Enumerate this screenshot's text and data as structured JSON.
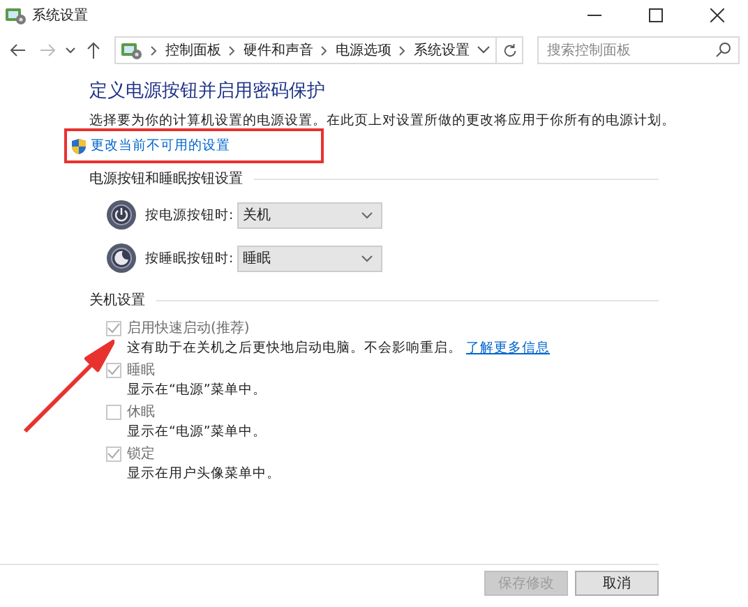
{
  "window": {
    "title": "系统设置"
  },
  "address_bar": {
    "crumbs": [
      "控制面板",
      "硬件和声音",
      "电源选项",
      "系统设置"
    ]
  },
  "search": {
    "placeholder": "搜索控制面板"
  },
  "heading": "定义电源按钮并启用密码保护",
  "description": "选择要为你的计算机设置的电源设置。在此页上对设置所做的更改将应用于你所有的电源计划。",
  "admin_link": {
    "label": "更改当前不可用的设置",
    "highlighted": true
  },
  "power_section": {
    "title": "电源按钮和睡眠按钮设置",
    "rows": [
      {
        "kind": "power",
        "label": "按电源按钮时:",
        "value": "关机",
        "disabled": true
      },
      {
        "kind": "sleep",
        "label": "按睡眠按钮时:",
        "value": "睡眠",
        "disabled": true
      }
    ]
  },
  "shutdown_section": {
    "title": "关机设置",
    "options": [
      {
        "label": "启用快速启动(推荐)",
        "checked": true,
        "disabled": true,
        "description": "这有助于在关机之后更快地启动电脑。不会影响重启。",
        "link": "了解更多信息"
      },
      {
        "label": "睡眠",
        "checked": true,
        "disabled": true,
        "description": "显示在“电源”菜单中。"
      },
      {
        "label": "休眠",
        "checked": false,
        "disabled": true,
        "description": "显示在“电源”菜单中。"
      },
      {
        "label": "锁定",
        "checked": true,
        "disabled": true,
        "description": "显示在用户头像菜单中。"
      }
    ]
  },
  "annotation_arrow": true,
  "buttons": [
    {
      "label": "保存修改",
      "disabled": true
    },
    {
      "label": "取消",
      "disabled": false
    }
  ]
}
